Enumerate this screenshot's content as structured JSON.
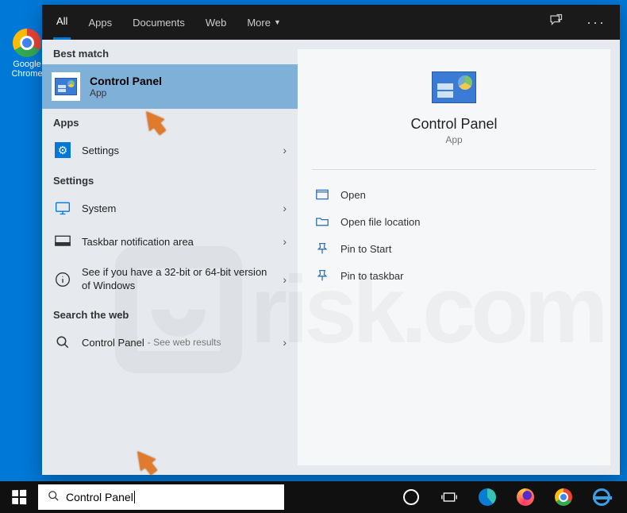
{
  "desktop": {
    "chrome_label": "Google Chrome"
  },
  "tabs": {
    "all": "All",
    "apps": "Apps",
    "documents": "Documents",
    "web": "Web",
    "more": "More"
  },
  "sections": {
    "best_match": "Best match",
    "apps": "Apps",
    "settings": "Settings",
    "search_web": "Search the web"
  },
  "best_match": {
    "title": "Control Panel",
    "subtitle": "App"
  },
  "apps_list": [
    {
      "label": "Settings"
    }
  ],
  "settings_list": [
    {
      "label": "System"
    },
    {
      "label": "Taskbar notification area"
    },
    {
      "label": "See if you have a 32-bit or 64-bit version of Windows"
    }
  ],
  "web_list": [
    {
      "label": "Control Panel",
      "suffix": "- See web results"
    }
  ],
  "preview": {
    "title": "Control Panel",
    "subtitle": "App"
  },
  "actions": [
    {
      "label": "Open",
      "icon": "open"
    },
    {
      "label": "Open file location",
      "icon": "folder"
    },
    {
      "label": "Pin to Start",
      "icon": "pin"
    },
    {
      "label": "Pin to taskbar",
      "icon": "pin"
    }
  ],
  "search": {
    "value": "Control Panel"
  },
  "watermark": "risk.com"
}
